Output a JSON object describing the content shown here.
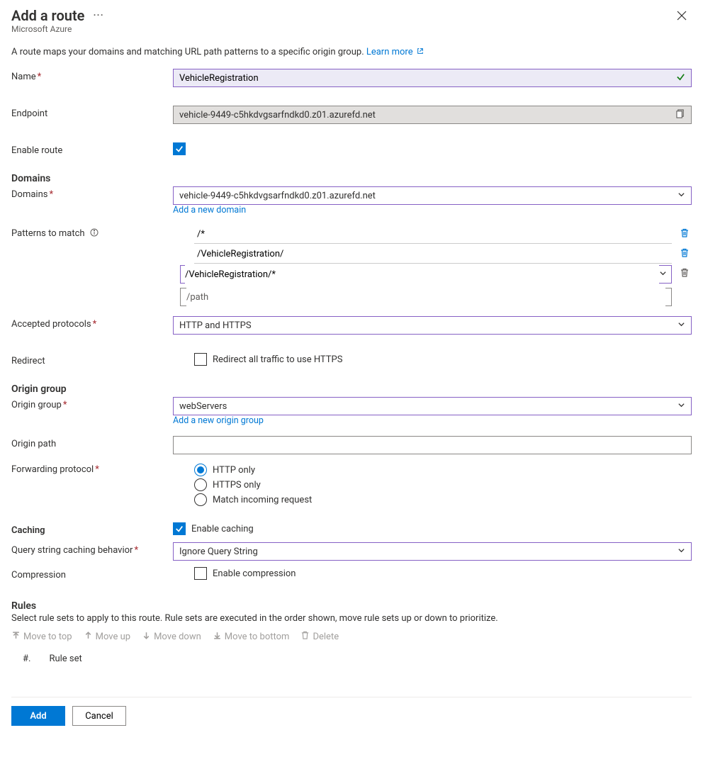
{
  "header": {
    "title": "Add a route",
    "subtitle": "Microsoft Azure"
  },
  "intro": {
    "text": "A route maps your domains and matching URL path patterns to a specific origin group. ",
    "learn_more": "Learn more"
  },
  "fields": {
    "name_label": "Name",
    "name_value": "VehicleRegistration",
    "endpoint_label": "Endpoint",
    "endpoint_value": "vehicle-9449-c5hkdvgsarfndkd0.z01.azurefd.net",
    "enable_route_label": "Enable route"
  },
  "domains": {
    "section": "Domains",
    "label": "Domains",
    "value": "vehicle-9449-c5hkdvgsarfndkd0.z01.azurefd.net",
    "add_new": "Add a new domain",
    "patterns_label": "Patterns to match",
    "patterns": [
      "/*",
      "/VehicleRegistration/",
      "/VehicleRegistration/*"
    ],
    "path_placeholder": "/path",
    "accepted_label": "Accepted protocols",
    "accepted_value": "HTTP and HTTPS",
    "redirect_label": "Redirect",
    "redirect_text": "Redirect all traffic to use HTTPS"
  },
  "origin": {
    "section": "Origin group",
    "label": "Origin group",
    "value": "webServers",
    "add_new": "Add a new origin group",
    "origin_path_label": "Origin path",
    "origin_path_value": "",
    "forwarding_label": "Forwarding protocol",
    "forwarding_options": [
      "HTTP only",
      "HTTPS only",
      "Match incoming request"
    ],
    "forwarding_selected": 0
  },
  "caching": {
    "section": "Caching",
    "enable_text": "Enable caching",
    "qs_label": "Query string caching behavior",
    "qs_value": "Ignore Query String",
    "compression_label": "Compression",
    "compression_text": "Enable compression"
  },
  "rules": {
    "section": "Rules",
    "desc": "Select rule sets to apply to this route. Rule sets are executed in the order shown, move rule sets up or down to prioritize.",
    "toolbar": {
      "top": "Move to top",
      "up": "Move up",
      "down": "Move down",
      "bottom": "Move to bottom",
      "delete": "Delete"
    },
    "col_num": "#.",
    "col_name": "Rule set"
  },
  "footer": {
    "add": "Add",
    "cancel": "Cancel"
  }
}
